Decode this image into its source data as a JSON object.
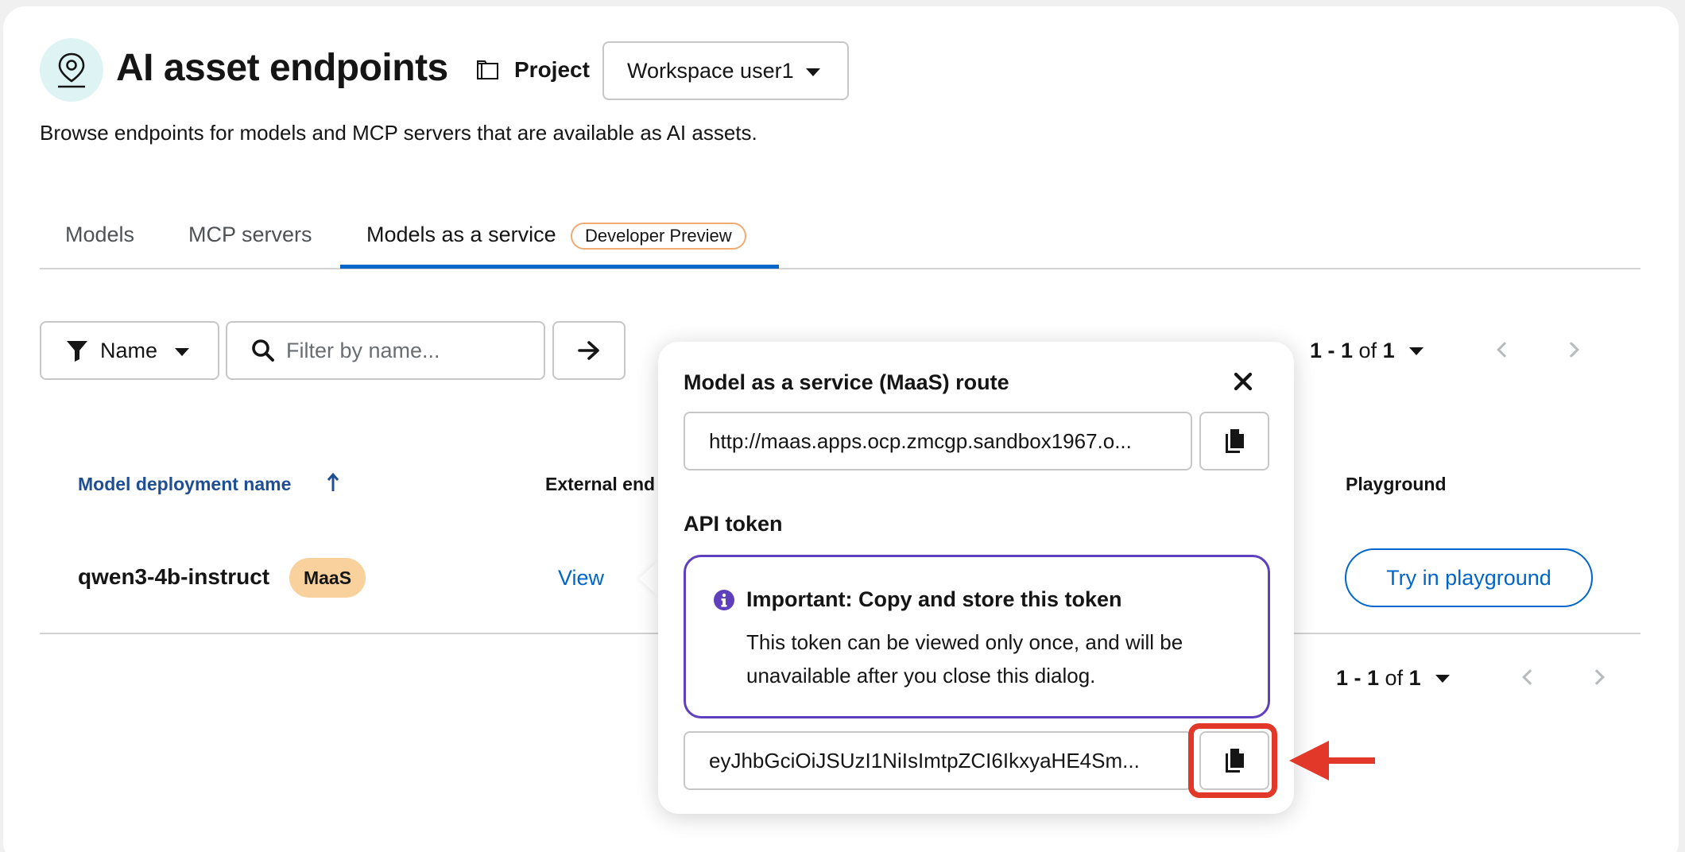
{
  "header": {
    "title": "AI asset endpoints",
    "project_label": "Project",
    "project_selected": "Workspace user1",
    "description": "Browse endpoints for models and MCP servers that are available as AI assets."
  },
  "tabs": [
    {
      "label": "Models"
    },
    {
      "label": "MCP servers"
    },
    {
      "label": "Models as a service",
      "badge": "Developer Preview",
      "active": true
    }
  ],
  "toolbar": {
    "filter_label": "Name",
    "search_placeholder": "Filter by name...",
    "pagination_top": {
      "range": "1 - 1",
      "of": "of",
      "total": "1"
    }
  },
  "table": {
    "headers": {
      "name": "Model deployment name",
      "external": "External end",
      "playground": "Playground"
    },
    "rows": [
      {
        "name": "qwen3-4b-instruct",
        "badge": "MaaS",
        "external_link": "View",
        "playground_button": "Try in playground"
      }
    ],
    "pagination_bottom": {
      "range": "1 - 1",
      "of": "of",
      "total": "1"
    }
  },
  "popover": {
    "title": "Model as a service (MaaS) route",
    "route_value": "http://maas.apps.ocp.zmcgp.sandbox1967.o...",
    "api_token_label": "API token",
    "alert_title": "Important: Copy and store this token",
    "alert_body": "This token can be viewed only once, and will be unavailable after you close this dialog.",
    "token_value": "eyJhbGciOiJSUzI1NiIsImtpZCI6IkxyaHE4Sm..."
  },
  "colors": {
    "accent": "#0066cc",
    "alert_border": "#5e40be",
    "badge_bg": "#f8d19c",
    "annotation": "#e1382a"
  }
}
